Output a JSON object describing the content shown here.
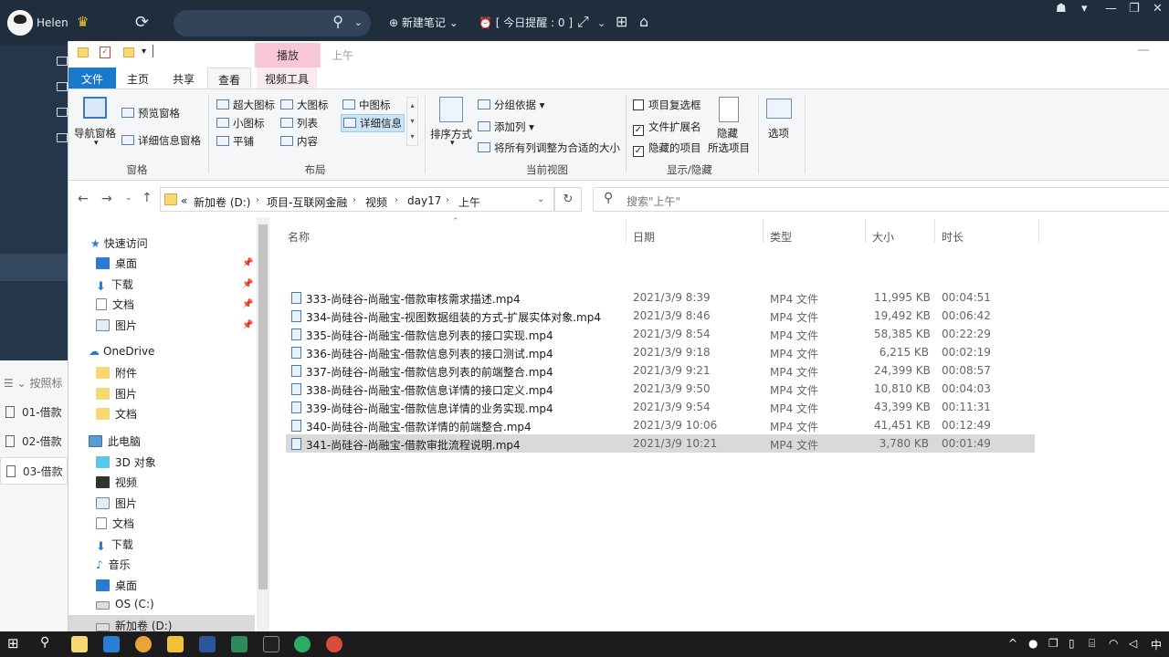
{
  "app": {
    "username": "Helen",
    "new_note": "新建笔记",
    "reminder": "[ 今日提醒 : 0 ]",
    "list_sort": "按照标",
    "notes": [
      "01-借款",
      "02-借款",
      "03-借款"
    ]
  },
  "explorer": {
    "title": "上午",
    "context_tab": "播放",
    "tabs": [
      "文件",
      "主页",
      "共享",
      "查看",
      "视频工具"
    ],
    "active_tab": "查看",
    "ribbon": {
      "nav_pane": "导航窗格",
      "preview_pane": "预览窗格",
      "details_pane": "详细信息窗格",
      "group_panes": "窗格",
      "layout": [
        "超大图标",
        "大图标",
        "中图标",
        "小图标",
        "列表",
        "详细信息",
        "平铺",
        "内容"
      ],
      "group_layout": "布局",
      "sort_by": "排序方式",
      "group_by": "分组依据",
      "add_column": "添加列",
      "fit_columns": "将所有列调整为合适的大小",
      "group_current_view": "当前视图",
      "item_checkboxes": "项目复选框",
      "file_extensions": "文件扩展名",
      "hidden_items": "隐藏的项目",
      "hide_selected": "隐藏",
      "hide_selected_2": "所选项目",
      "group_show_hide": "显示/隐藏",
      "options": "选项"
    },
    "breadcrumb": [
      "«",
      "新加卷 (D:)",
      "项目-互联网金融",
      "视频",
      "day17",
      "上午"
    ],
    "search_placeholder": "搜索\"上午\"",
    "nav": {
      "quick_access": "快速访问",
      "quick_items": [
        "桌面",
        "下载",
        "文档",
        "图片"
      ],
      "onedrive": "OneDrive",
      "onedrive_items": [
        "附件",
        "图片",
        "文档"
      ],
      "this_pc": "此电脑",
      "pc_items": [
        "3D 对象",
        "视频",
        "图片",
        "文档",
        "下载",
        "音乐",
        "桌面",
        "OS (C:)",
        "新加卷 (D:)"
      ]
    },
    "columns": [
      "名称",
      "日期",
      "类型",
      "大小",
      "时长"
    ],
    "files": [
      {
        "name": "333-尚硅谷-尚融宝-借款审核需求描述.mp4",
        "date": "2021/3/9 8:39",
        "type": "MP4 文件",
        "size": "11,995 KB",
        "duration": "00:04:51"
      },
      {
        "name": "334-尚硅谷-尚融宝-视图数据组装的方式-扩展实体对象.mp4",
        "date": "2021/3/9 8:46",
        "type": "MP4 文件",
        "size": "19,492 KB",
        "duration": "00:06:42"
      },
      {
        "name": "335-尚硅谷-尚融宝-借款信息列表的接口实现.mp4",
        "date": "2021/3/9 8:54",
        "type": "MP4 文件",
        "size": "58,385 KB",
        "duration": "00:22:29"
      },
      {
        "name": "336-尚硅谷-尚融宝-借款信息列表的接口测试.mp4",
        "date": "2021/3/9 9:18",
        "type": "MP4 文件",
        "size": "6,215 KB",
        "duration": "00:02:19"
      },
      {
        "name": "337-尚硅谷-尚融宝-借款信息列表的前端整合.mp4",
        "date": "2021/3/9 9:21",
        "type": "MP4 文件",
        "size": "24,399 KB",
        "duration": "00:08:57"
      },
      {
        "name": "338-尚硅谷-尚融宝-借款信息详情的接口定义.mp4",
        "date": "2021/3/9 9:50",
        "type": "MP4 文件",
        "size": "10,810 KB",
        "duration": "00:04:03"
      },
      {
        "name": "339-尚硅谷-尚融宝-借款信息详情的业务实现.mp4",
        "date": "2021/3/9 9:54",
        "type": "MP4 文件",
        "size": "43,399 KB",
        "duration": "00:11:31"
      },
      {
        "name": "340-尚硅谷-尚融宝-借款详情的前端整合.mp4",
        "date": "2021/3/9 10:06",
        "type": "MP4 文件",
        "size": "41,451 KB",
        "duration": "00:12:49"
      },
      {
        "name": "341-尚硅谷-尚融宝-借款审批流程说明.mp4",
        "date": "2021/3/9 10:21",
        "type": "MP4 文件",
        "size": "3,780 KB",
        "duration": "00:01:49"
      }
    ],
    "selected_index": 8
  },
  "taskbar": {
    "ime": "中"
  }
}
